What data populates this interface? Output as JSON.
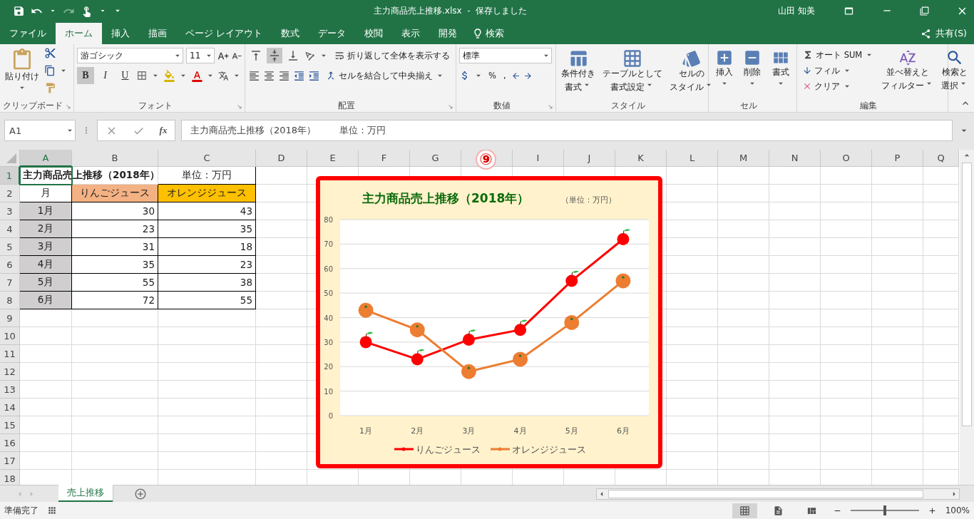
{
  "title_bar": {
    "title": "主力商品売上推移.xlsx  -  保存しました",
    "user": "山田 知美"
  },
  "menu_tabs": [
    {
      "label": "ファイル",
      "selected": false
    },
    {
      "label": "ホーム",
      "selected": true
    },
    {
      "label": "挿入",
      "selected": false
    },
    {
      "label": "描画",
      "selected": false
    },
    {
      "label": "ページ レイアウト",
      "selected": false
    },
    {
      "label": "数式",
      "selected": false
    },
    {
      "label": "データ",
      "selected": false
    },
    {
      "label": "校閲",
      "selected": false
    },
    {
      "label": "表示",
      "selected": false
    },
    {
      "label": "開発",
      "selected": false
    }
  ],
  "tell_me": "検索",
  "share": "共有(S)",
  "ribbon": {
    "clipboard": {
      "label": "クリップボード",
      "paste": "貼り付け"
    },
    "font": {
      "label": "フォント",
      "font_name": "游ゴシック",
      "font_size": "11",
      "styles": [
        {
          "label": "B",
          "selected": true
        },
        {
          "label": "I",
          "selected": false
        },
        {
          "label": "U",
          "selected": false
        }
      ]
    },
    "alignment": {
      "label": "配置",
      "vertical": [
        {
          "selected": false
        },
        {
          "selected": true
        },
        {
          "selected": false
        }
      ],
      "wrap": "折り返して全体を表示する",
      "merge": "セルを結合して中央揃え"
    },
    "number": {
      "label": "数値",
      "format": "標準",
      "percent": "%",
      "comma": ","
    },
    "styles": {
      "label": "スタイル",
      "buttons": [
        [
          "条件付き",
          "書式"
        ],
        [
          "テーブルとして",
          "書式設定"
        ],
        [
          "セルの",
          "スタイル"
        ]
      ]
    },
    "cells": {
      "label": "セル",
      "buttons": [
        "挿入",
        "削除",
        "書式"
      ]
    },
    "editing": {
      "label": "編集",
      "autosum": "オート SUM",
      "fill": "フィル",
      "clear": "クリア",
      "sort": [
        "並べ替えと",
        "フィルター"
      ],
      "find": [
        "検索と",
        "選択"
      ]
    }
  },
  "formula_bar": {
    "name_box": "A1",
    "fx": "fx",
    "content": "主力商品売上推移（2018年）        単位：万円"
  },
  "sheet": {
    "columns": [
      {
        "label": "A",
        "selected": true
      },
      {
        "label": "B",
        "selected": false
      },
      {
        "label": "C",
        "selected": false
      },
      {
        "label": "D",
        "selected": false
      },
      {
        "label": "E",
        "selected": false
      },
      {
        "label": "F",
        "selected": false
      },
      {
        "label": "G",
        "selected": false
      },
      {
        "selected": false
      },
      {
        "label": "I",
        "selected": false
      },
      {
        "label": "J",
        "selected": false
      },
      {
        "label": "K",
        "selected": false
      },
      {
        "label": "L",
        "selected": false
      },
      {
        "label": "M",
        "selected": false
      },
      {
        "label": "N",
        "selected": false
      },
      {
        "label": "O",
        "selected": false
      },
      {
        "label": "P",
        "selected": false
      },
      {
        "label": "Q",
        "selected": false
      }
    ],
    "rows": [
      {
        "label": "1",
        "selected": true,
        "kind": "title",
        "title": "主力商品売上推移（2018年）",
        "note": "単位：万円"
      },
      {
        "label": "2",
        "selected": false,
        "kind": "header",
        "cells": [
          {
            "text": "月",
            "color": "#ffffff"
          },
          {
            "text": "りんごジュース",
            "color": "#f4b183"
          },
          {
            "text": "オレンジジュース",
            "color": "#ffc000"
          }
        ]
      },
      {
        "label": "3",
        "selected": false,
        "kind": "data",
        "cells": [
          "1月",
          "30",
          "43"
        ]
      },
      {
        "label": "4",
        "selected": false,
        "kind": "data",
        "cells": [
          "2月",
          "23",
          "35"
        ]
      },
      {
        "label": "5",
        "selected": false,
        "kind": "data",
        "cells": [
          "3月",
          "31",
          "18"
        ]
      },
      {
        "label": "6",
        "selected": false,
        "kind": "data",
        "cells": [
          "4月",
          "35",
          "23"
        ]
      },
      {
        "label": "7",
        "selected": false,
        "kind": "data",
        "cells": [
          "5月",
          "55",
          "38"
        ]
      },
      {
        "label": "8",
        "selected": false,
        "kind": "data",
        "cells": [
          "6月",
          "72",
          "55"
        ]
      },
      {
        "label": "9",
        "selected": false,
        "kind": "empty"
      },
      {
        "label": "10",
        "selected": false,
        "kind": "empty"
      },
      {
        "label": "11",
        "selected": false,
        "kind": "empty"
      },
      {
        "label": "12",
        "selected": false,
        "kind": "empty"
      },
      {
        "label": "13",
        "selected": false,
        "kind": "empty"
      },
      {
        "label": "14",
        "selected": false,
        "kind": "empty"
      },
      {
        "label": "15",
        "selected": false,
        "kind": "empty"
      },
      {
        "label": "16",
        "selected": false,
        "kind": "empty"
      },
      {
        "label": "17",
        "selected": false,
        "kind": "empty"
      },
      {
        "label": "18",
        "selected": false,
        "kind": "empty"
      }
    ]
  },
  "step_badge": "⑨",
  "chart": {
    "unit_label": "（単位：万円）",
    "chart_data": {
      "type": "line",
      "title": "主力商品売上推移（2018年）",
      "categories": [
        "1月",
        "2月",
        "3月",
        "4月",
        "5月",
        "6月"
      ],
      "series": [
        {
          "name": "りんごジュース",
          "color": "#ff0000",
          "marker": "circle",
          "values": [
            30,
            23,
            31,
            35,
            55,
            72
          ]
        },
        {
          "name": "オレンジジュース",
          "color": "#ed7d31",
          "marker": "circle",
          "values": [
            43,
            35,
            18,
            23,
            38,
            55
          ]
        }
      ],
      "grid": true,
      "legend": true,
      "ylim": [
        0,
        80
      ],
      "yticks": [
        0,
        10,
        20,
        30,
        40,
        50,
        60,
        70,
        80
      ]
    }
  },
  "sheet_tabs": [
    {
      "label": "売上推移",
      "selected": true
    }
  ],
  "status_bar": {
    "text": "準備完了",
    "views": [
      {
        "selected": true
      },
      {
        "selected": false
      },
      {
        "selected": false
      }
    ],
    "zoom": {
      "level": 0.5
    },
    "zoom_label": "100%"
  }
}
